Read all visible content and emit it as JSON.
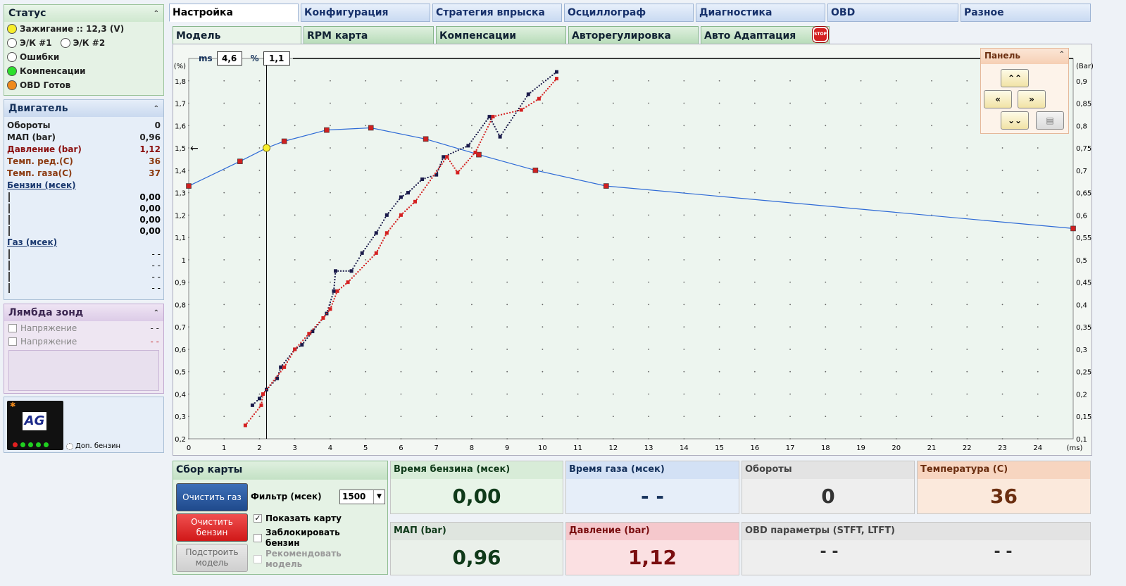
{
  "status": {
    "title": "Статус",
    "items": [
      {
        "label": "Зажигание :: 12,3 (V)",
        "color": "#f7ee2a"
      },
      {
        "label": "Э/К #1",
        "color": "#ffffff"
      },
      {
        "label": "Э/К #2",
        "color": "#ffffff"
      },
      {
        "label": "Ошибки",
        "color": "#ffffff"
      },
      {
        "label": "Компенсации",
        "color": "#2de02d"
      },
      {
        "label": "OBD Готов",
        "color": "#f08a1c"
      }
    ]
  },
  "engine": {
    "title": "Двигатель",
    "rows": [
      {
        "label": "Обороты",
        "value": "0",
        "color": "#222"
      },
      {
        "label": "МАП (bar)",
        "value": "0,96",
        "color": "#222"
      },
      {
        "label": "Давление (bar)",
        "value": "1,12",
        "color": "#8b1010"
      },
      {
        "label": "Темп. ред.(C)",
        "value": "36",
        "color": "#8b3a10"
      },
      {
        "label": "Темп. газа(C)",
        "value": "37",
        "color": "#8b3a10"
      }
    ],
    "petrol_label": "Бензин (мсек)",
    "petrol_values": [
      "0,00",
      "0,00",
      "0,00",
      "0,00"
    ],
    "gas_label": "Газ (мсек)",
    "gas_values": [
      "- -",
      "- -",
      "- -",
      "- -"
    ]
  },
  "lambda": {
    "title": "Лямбда зонд",
    "rows": [
      {
        "label": "Напряжение",
        "value": "- -",
        "color": "#333"
      },
      {
        "label": "Напряжение",
        "value": "- -",
        "color": "#c02020"
      }
    ]
  },
  "logo": {
    "text": "AG",
    "side_text": "Доп. бензин"
  },
  "tabs": [
    "Настройка",
    "Конфигурация",
    "Стратегия впрыска",
    "Осциллограф",
    "Диагностика",
    "OBD",
    "Разное"
  ],
  "subtabs": [
    "Модель",
    "RPM карта",
    "Компенсации",
    "Авторегулировка",
    "Авто Адаптация"
  ],
  "stop_label": "STOP",
  "chart_header": {
    "ms_label": "ms",
    "ms_value": "4,6",
    "pct_label": "%",
    "pct_value": "1,1"
  },
  "panel": {
    "title": "Панель",
    "buttons": [
      "up-button",
      "left-button",
      "right-button",
      "down-button",
      "clipboard-button"
    ]
  },
  "chart_data": {
    "type": "scatter",
    "xlabel": "(ms)",
    "ylabel_left": "(%)",
    "ylabel_right": "(Bar)",
    "xlim": [
      0,
      25
    ],
    "ylim_left": [
      0.2,
      1.9
    ],
    "ylim_right": [
      0.1,
      0.95
    ],
    "x_ticks": [
      0,
      1,
      2,
      3,
      4,
      5,
      6,
      7,
      8,
      9,
      10,
      11,
      12,
      13,
      14,
      15,
      16,
      17,
      18,
      19,
      20,
      21,
      22,
      23,
      24
    ],
    "y_left_ticks": [
      "0,2",
      "0,3",
      "0,4",
      "0,5",
      "0,6",
      "0,7",
      "0,8",
      "0,9",
      "1",
      "1,1",
      "1,2",
      "1,3",
      "1,4",
      "1,5",
      "1,6",
      "1,7",
      "1,8"
    ],
    "y_right_ticks": [
      "0,1",
      "0,15",
      "0,2",
      "0,25",
      "0,3",
      "0,35",
      "0,4",
      "0,45",
      "0,5",
      "0,55",
      "0,6",
      "0,65",
      "0,7",
      "0,75",
      "0,8",
      "0,85",
      "0,9"
    ],
    "cursor_x": 2.2,
    "cursor_y": 1.5,
    "series": [
      {
        "color": "#2e6ad6",
        "line": true,
        "points": [
          [
            0,
            1.33
          ],
          [
            1.45,
            1.44
          ],
          [
            2.2,
            1.5
          ],
          [
            2.7,
            1.53
          ],
          [
            3.9,
            1.58
          ],
          [
            5.15,
            1.59
          ],
          [
            6.7,
            1.54
          ],
          [
            8.2,
            1.47
          ],
          [
            9.8,
            1.4
          ],
          [
            11.8,
            1.33
          ],
          [
            25,
            1.14
          ]
        ]
      },
      {
        "color": "#1a1a4a",
        "line": false,
        "points": [
          [
            1.8,
            0.35
          ],
          [
            2.0,
            0.38
          ],
          [
            2.2,
            0.42
          ],
          [
            2.5,
            0.47
          ],
          [
            2.6,
            0.52
          ],
          [
            3.0,
            0.6
          ],
          [
            3.2,
            0.62
          ],
          [
            3.5,
            0.68
          ],
          [
            3.9,
            0.76
          ],
          [
            4.1,
            0.86
          ],
          [
            4.15,
            0.95
          ],
          [
            4.6,
            0.95
          ],
          [
            4.9,
            1.03
          ],
          [
            5.3,
            1.12
          ],
          [
            5.6,
            1.2
          ],
          [
            6.0,
            1.28
          ],
          [
            6.2,
            1.3
          ],
          [
            6.6,
            1.36
          ],
          [
            7.0,
            1.38
          ],
          [
            7.2,
            1.46
          ],
          [
            7.9,
            1.51
          ],
          [
            8.5,
            1.64
          ],
          [
            8.8,
            1.55
          ],
          [
            9.6,
            1.74
          ],
          [
            10.4,
            1.84
          ]
        ]
      },
      {
        "color": "#d42020",
        "line": false,
        "points": [
          [
            1.6,
            0.26
          ],
          [
            2.05,
            0.35
          ],
          [
            2.1,
            0.4
          ],
          [
            2.7,
            0.52
          ],
          [
            3.0,
            0.6
          ],
          [
            3.4,
            0.67
          ],
          [
            3.8,
            0.74
          ],
          [
            4.0,
            0.78
          ],
          [
            4.2,
            0.86
          ],
          [
            4.5,
            0.9
          ],
          [
            5.3,
            1.03
          ],
          [
            5.6,
            1.12
          ],
          [
            6.0,
            1.2
          ],
          [
            6.4,
            1.26
          ],
          [
            7.3,
            1.46
          ],
          [
            7.6,
            1.39
          ],
          [
            8.1,
            1.48
          ],
          [
            8.6,
            1.64
          ],
          [
            9.4,
            1.67
          ],
          [
            9.9,
            1.72
          ],
          [
            10.4,
            1.81
          ]
        ]
      }
    ]
  },
  "collect": {
    "title": "Сбор карты",
    "clear_gas": "Очистить газ",
    "clear_petrol": "Очистить бензин",
    "build_model": "Подстроить модель",
    "filter_label": "Фильтр (мсек)",
    "filter_value": "1500",
    "show_map": "Показать карту",
    "lock_petrol": "Заблокировать бензин",
    "recommend": "Рекомендовать модель"
  },
  "readouts": [
    {
      "label": "Время бензина (мсек)",
      "value": "0,00",
      "head": "#d8ecd8",
      "bg": "#e8f4e8",
      "color": "#103a1a"
    },
    {
      "label": "Время газа (мсек)",
      "value": "- -",
      "head": "#d3e1f5",
      "bg": "#e6eef9",
      "color": "#16325c"
    },
    {
      "label": "Обороты",
      "value": "0",
      "head": "#e3e3e3",
      "bg": "#eeeeee",
      "color": "#333"
    },
    {
      "label": "Температура (C)",
      "value": "36",
      "head": "#f7d5c0",
      "bg": "#fbe9dc",
      "color": "#6b2e10"
    },
    {
      "label": "МАП (bar)",
      "value": "0,96",
      "head": "#dfe5df",
      "bg": "#eaf0ea",
      "color": "#103a1a"
    },
    {
      "label": "Давление (bar)",
      "value": "1,12",
      "head": "#f5c8cc",
      "bg": "#fbe0e2",
      "color": "#7a0e10"
    },
    {
      "label": "OBD параметры (STFT, LTFT)",
      "value1": "- -",
      "value2": "- -",
      "head": "#e3e3e3",
      "bg": "#eeeeee",
      "color": "#333"
    }
  ]
}
